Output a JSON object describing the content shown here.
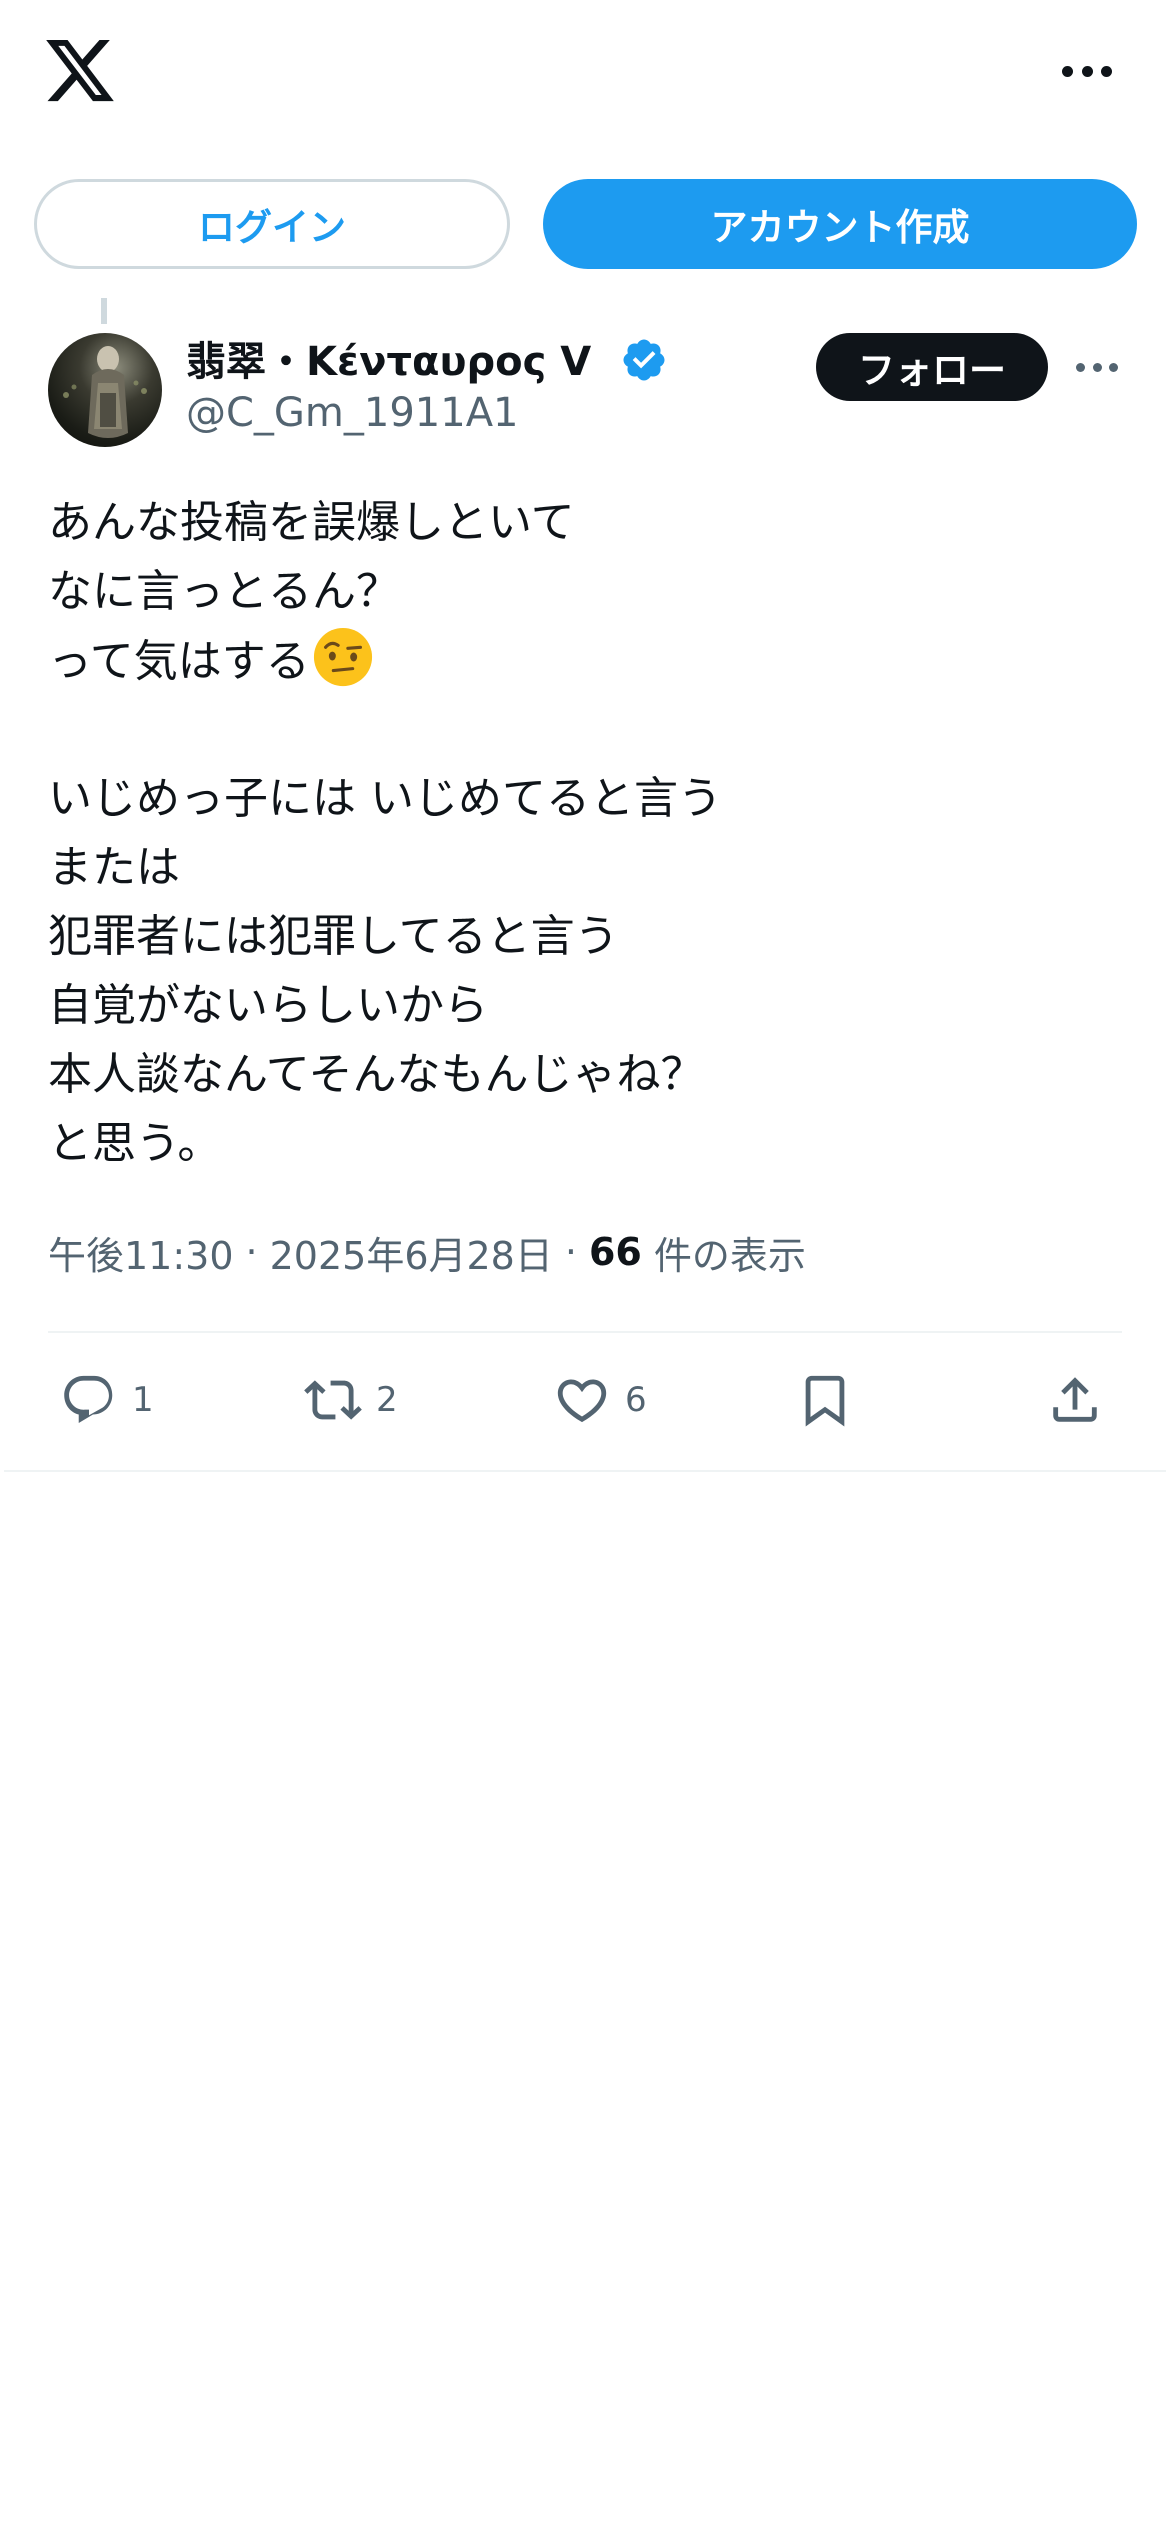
{
  "header": {
    "logo_icon": "x-logo-icon",
    "more_icon": "more-horizontal-icon"
  },
  "auth": {
    "login_label": "ログイン",
    "signup_label": "アカウント作成"
  },
  "tweet": {
    "author": {
      "display_name": "翡翠・Κένταυρος V",
      "verified": true,
      "handle": "@C_Gm_1911A1"
    },
    "follow_label": "フォロー",
    "text_lines": [
      "あんな投稿を誤爆しといて",
      "なに言っとるん？",
      "って気はする",
      "",
      "いじめっ子には いじめてると言う",
      "または",
      "犯罪者には犯罪してると言う",
      "自覚がないらしいから",
      "本人談なんてそんなもんじゃね？",
      "と思う。"
    ],
    "emoji": "face-with-raised-eyebrow",
    "time": "午後11:30",
    "separator": "·",
    "date": "2025年6月28日",
    "views_count": "66",
    "views_label": "件の表示",
    "actions": {
      "replies": "1",
      "retweets": "2",
      "likes": "6"
    }
  },
  "colors": {
    "accent": "#1d9bf0",
    "text_primary": "#0f1419",
    "text_secondary": "#536471",
    "border": "#cfd9de",
    "divider": "#eff3f4"
  }
}
